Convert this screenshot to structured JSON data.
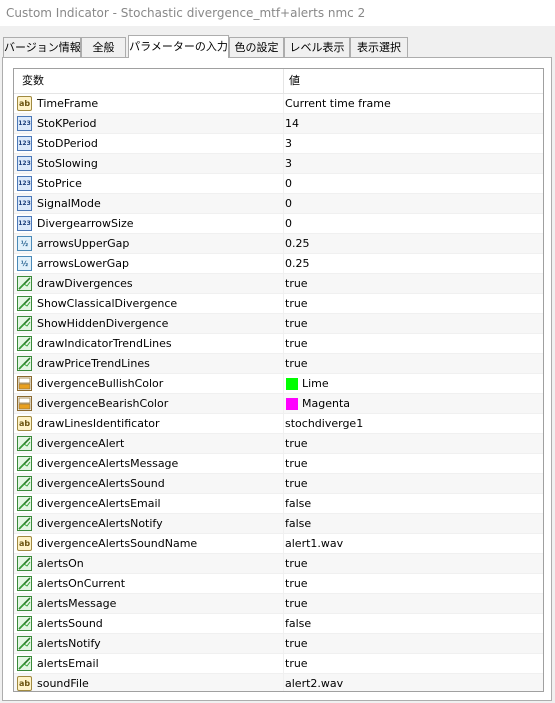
{
  "window": {
    "title": "Custom Indicator - Stochastic divergence_mtf+alerts nmc 2"
  },
  "tabs": [
    {
      "label": "バージョン情報",
      "active": false
    },
    {
      "label": "全般",
      "active": false
    },
    {
      "label": "パラメーターの入力",
      "active": true
    },
    {
      "label": "色の設定",
      "active": false
    },
    {
      "label": "レベル表示",
      "active": false
    },
    {
      "label": "表示選択",
      "active": false
    }
  ],
  "grid": {
    "col_variable": "変数",
    "col_value": "値",
    "rows": [
      {
        "type": "string",
        "icon": "ab",
        "name": "TimeFrame",
        "value": "Current time frame"
      },
      {
        "type": "int",
        "icon": "123",
        "name": "StoKPeriod",
        "value": "14"
      },
      {
        "type": "int",
        "icon": "123",
        "name": "StoDPeriod",
        "value": "3"
      },
      {
        "type": "int",
        "icon": "123",
        "name": "StoSlowing",
        "value": "3"
      },
      {
        "type": "int",
        "icon": "123",
        "name": "StoPrice",
        "value": "0"
      },
      {
        "type": "int",
        "icon": "123",
        "name": "SignalMode",
        "value": "0"
      },
      {
        "type": "int",
        "icon": "123",
        "name": "DivergearrowSize",
        "value": "0"
      },
      {
        "type": "double",
        "icon": "½",
        "name": "arrowsUpperGap",
        "value": "0.25"
      },
      {
        "type": "double",
        "icon": "½",
        "name": "arrowsLowerGap",
        "value": "0.25"
      },
      {
        "type": "bool",
        "icon": "",
        "name": "drawDivergences",
        "value": "true"
      },
      {
        "type": "bool",
        "icon": "",
        "name": "ShowClassicalDivergence",
        "value": "true"
      },
      {
        "type": "bool",
        "icon": "",
        "name": "ShowHiddenDivergence",
        "value": "true"
      },
      {
        "type": "bool",
        "icon": "",
        "name": "drawIndicatorTrendLines",
        "value": "true"
      },
      {
        "type": "bool",
        "icon": "",
        "name": "drawPriceTrendLines",
        "value": "true"
      },
      {
        "type": "color",
        "icon": "",
        "name": "divergenceBullishColor",
        "value": "Lime",
        "color": "#00ff00"
      },
      {
        "type": "color",
        "icon": "",
        "name": "divergenceBearishColor",
        "value": "Magenta",
        "color": "#ff00ff"
      },
      {
        "type": "string",
        "icon": "ab",
        "name": "drawLinesIdentificator",
        "value": "stochdiverge1"
      },
      {
        "type": "bool",
        "icon": "",
        "name": "divergenceAlert",
        "value": "true"
      },
      {
        "type": "bool",
        "icon": "",
        "name": "divergenceAlertsMessage",
        "value": "true"
      },
      {
        "type": "bool",
        "icon": "",
        "name": "divergenceAlertsSound",
        "value": "true"
      },
      {
        "type": "bool",
        "icon": "",
        "name": "divergenceAlertsEmail",
        "value": "false"
      },
      {
        "type": "bool",
        "icon": "",
        "name": "divergenceAlertsNotify",
        "value": "false"
      },
      {
        "type": "string",
        "icon": "ab",
        "name": "divergenceAlertsSoundName",
        "value": "alert1.wav"
      },
      {
        "type": "bool",
        "icon": "",
        "name": "alertsOn",
        "value": "true"
      },
      {
        "type": "bool",
        "icon": "",
        "name": "alertsOnCurrent",
        "value": "true"
      },
      {
        "type": "bool",
        "icon": "",
        "name": "alertsMessage",
        "value": "true"
      },
      {
        "type": "bool",
        "icon": "",
        "name": "alertsSound",
        "value": "false"
      },
      {
        "type": "bool",
        "icon": "",
        "name": "alertsNotify",
        "value": "true"
      },
      {
        "type": "bool",
        "icon": "",
        "name": "alertsEmail",
        "value": "true"
      },
      {
        "type": "string",
        "icon": "ab",
        "name": "soundFile",
        "value": "alert2.wav"
      }
    ]
  }
}
